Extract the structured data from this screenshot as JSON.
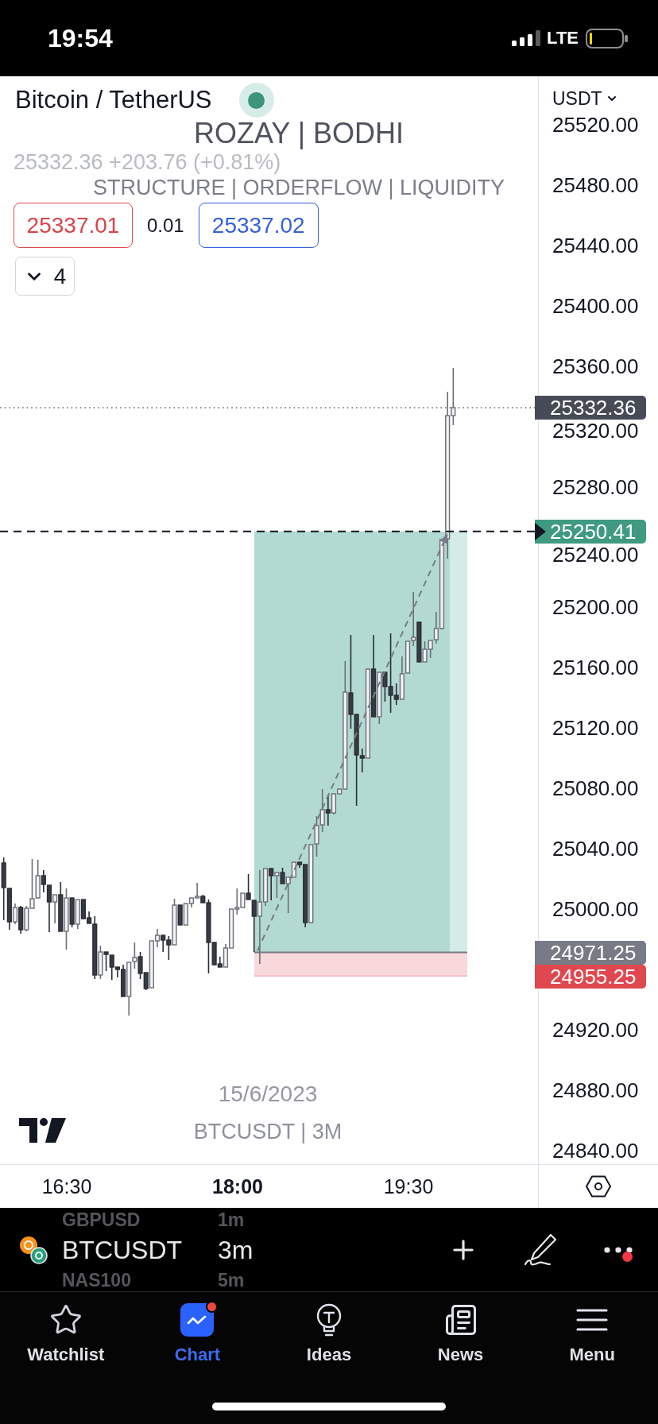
{
  "status_bar": {
    "time": "19:54",
    "network": "LTE"
  },
  "legend": {
    "symbol": "Bitcoin / TetherUS",
    "market_open": true,
    "price_line": "25332.36 +203.76 (+0.81%)",
    "sell_price": "25337.01",
    "spread": "0.01",
    "buy_price": "25337.02",
    "indicators_count": "4",
    "indicators_expanded": false
  },
  "watermark": {
    "title": "ROZAY | BODHI",
    "subtitle": "STRUCTURE | ORDERFLOW | LIQUIDITY",
    "date": "15/6/2023",
    "symbol_line": "BTCUSDT | 3M"
  },
  "price_axis": {
    "currency": "USDT",
    "labels": [
      "25520.00",
      "25480.00",
      "25440.00",
      "25400.00",
      "25360.00",
      "25320.00",
      "25280.00",
      "25240.00",
      "25200.00",
      "25160.00",
      "25120.00",
      "25080.00",
      "25040.00",
      "25000.00",
      "24920.00",
      "24880.00",
      "24840.00"
    ],
    "tags": [
      {
        "kind": "last",
        "text": "25332.36"
      },
      {
        "kind": "target",
        "text": "25250.41"
      },
      {
        "kind": "entry",
        "text": "24971.25"
      },
      {
        "kind": "stop",
        "text": "24955.25"
      }
    ]
  },
  "time_axis": {
    "labels": [
      {
        "text": "16:30",
        "emphasized": false
      },
      {
        "text": "18:00",
        "emphasized": true
      },
      {
        "text": "19:30",
        "emphasized": false
      }
    ]
  },
  "toolbar": {
    "symbols": [
      {
        "symbol": "GBPUSD",
        "interval": "1m",
        "selected": false
      },
      {
        "symbol": "BTCUSDT",
        "interval": "3m",
        "selected": true
      },
      {
        "symbol": "NAS100",
        "interval": "5m",
        "selected": false
      }
    ],
    "more_badge": true
  },
  "tabs": [
    {
      "label": "Watchlist",
      "selected": false,
      "badge": false
    },
    {
      "label": "Chart",
      "selected": true,
      "badge": true
    },
    {
      "label": "Ideas",
      "selected": false,
      "badge": false
    },
    {
      "label": "News",
      "selected": false,
      "badge": false
    },
    {
      "label": "Menu",
      "selected": false,
      "badge": false
    }
  ]
}
